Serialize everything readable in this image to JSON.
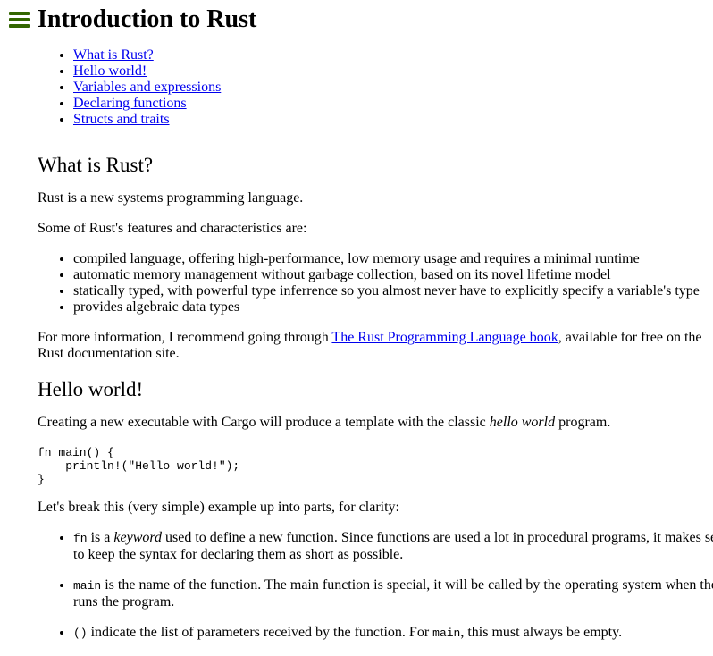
{
  "header": {
    "title": "Introduction to Rust",
    "menu_icon": "hamburger-menu-icon",
    "accent_color": "#336600"
  },
  "toc": [
    "What is Rust?",
    "Hello world!",
    "Variables and expressions",
    "Declaring functions",
    "Structs and traits"
  ],
  "sections": {
    "what_is_rust": {
      "heading": "What is Rust?",
      "intro": "Rust is a new systems programming language.",
      "features_intro": "Some of Rust's features and characteristics are:",
      "features": [
        "compiled language, offering high-performance, low memory usage and requires a minimal runtime",
        "automatic memory management without garbage collection, based on its novel lifetime model",
        "statically typed, with powerful type inferrence so you almost never have to explicitly specify a variable's type",
        "provides algebraic data types"
      ],
      "more_info_before": "For more information, I recommend going through ",
      "more_info_link": "The Rust Programming Language book",
      "more_info_after": ", available for free on the Rust documentation site."
    },
    "hello_world": {
      "heading": "Hello world!",
      "intro_before": "Creating a new executable with Cargo will produce a template with the classic ",
      "intro_em": "hello world",
      "intro_after": " program.",
      "code": "fn main() {\n    println!(\"Hello world!\");\n}",
      "breakdown_intro": "Let's break this (very simple) example up into parts, for clarity:",
      "points": [
        {
          "code": "fn",
          "text1": " is a ",
          "em": "keyword",
          "text2": " used to define a new function. Since functions are used a lot in procedural programs, it makes sense to keep the syntax for declaring them as short as possible."
        },
        {
          "code": "main",
          "text1": " is the name of the function. The main function is special, it will be called by the operating system when the user runs the program."
        },
        {
          "code": "()",
          "text1": " indicate the list of parameters received by the function. For ",
          "code2": "main",
          "text2": ", this must always be empty."
        }
      ]
    }
  }
}
